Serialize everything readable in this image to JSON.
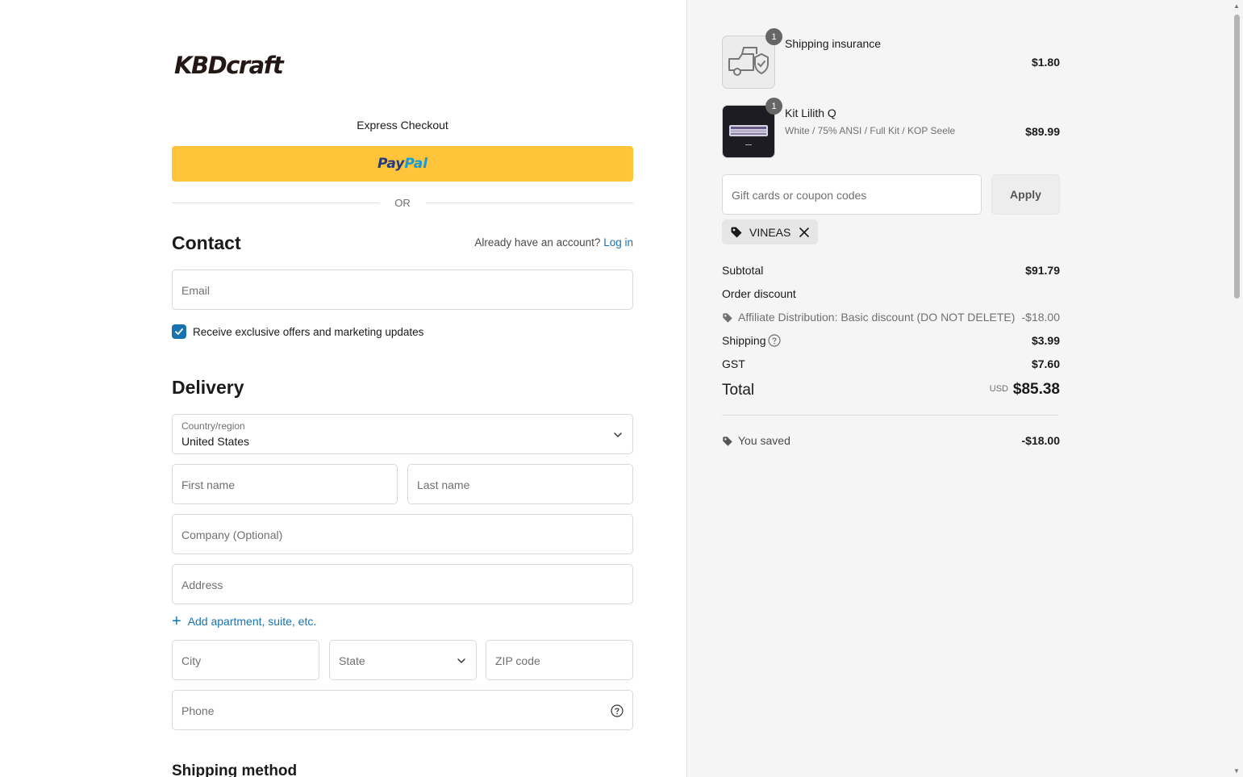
{
  "brand": {
    "logo_text": "KBDcraft"
  },
  "express": {
    "label": "Express Checkout",
    "paypal_part1": "Pay",
    "paypal_part2": "Pal",
    "or_text": "OR"
  },
  "contact": {
    "title": "Contact",
    "account_prompt": "Already have an account?",
    "login_link": "Log in",
    "email_placeholder": "Email",
    "marketing_label": "Receive exclusive offers and marketing updates",
    "marketing_checked": true
  },
  "delivery": {
    "title": "Delivery",
    "country_label": "Country/region",
    "country_value": "United States",
    "first_name_placeholder": "First name",
    "last_name_placeholder": "Last name",
    "company_placeholder": "Company (Optional)",
    "address_placeholder": "Address",
    "add_apartment": "Add apartment, suite, etc.",
    "city_placeholder": "City",
    "state_placeholder": "State",
    "zip_placeholder": "ZIP code",
    "phone_placeholder": "Phone"
  },
  "shipping_method": {
    "title": "Shipping method"
  },
  "cart": {
    "items": [
      {
        "title": "Shipping insurance",
        "variant": "",
        "quantity": "1",
        "price": "$1.80",
        "icon": "truck-shield-icon"
      },
      {
        "title": "Kit Lilith Q",
        "variant": "White / 75% ANSI / Full Kit / KOP Seele",
        "quantity": "1",
        "price": "$89.99",
        "icon": "keyboard-image"
      }
    ],
    "coupon_placeholder": "Gift cards or coupon codes",
    "apply_label": "Apply",
    "applied_code": "VINEAS"
  },
  "summary": {
    "subtotal_label": "Subtotal",
    "subtotal_value": "$91.79",
    "order_discount_label": "Order discount",
    "discount_name": "Affiliate Distribution: Basic discount (DO NOT DELETE)",
    "discount_value": "-$18.00",
    "shipping_label": "Shipping",
    "shipping_value": "$3.99",
    "gst_label": "GST",
    "gst_value": "$7.60",
    "total_label": "Total",
    "currency": "USD",
    "total_value": "$85.38",
    "saved_label": "You saved",
    "saved_value": "-$18.00"
  },
  "colors": {
    "accent": "#1773b0",
    "paypal_yellow": "#ffc439",
    "paypal_dark_blue": "#253b80",
    "paypal_light_blue": "#179bd7"
  }
}
